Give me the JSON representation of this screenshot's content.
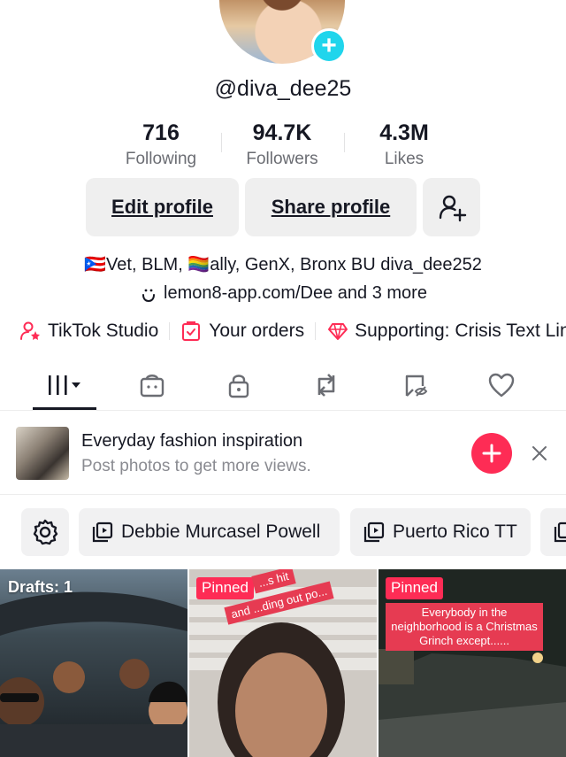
{
  "profile": {
    "username": "@diva_dee25",
    "stats": [
      {
        "value": "716",
        "label": "Following"
      },
      {
        "value": "94.7K",
        "label": "Followers"
      },
      {
        "value": "4.3M",
        "label": "Likes"
      }
    ],
    "buttons": {
      "edit": "Edit profile",
      "share": "Share profile"
    },
    "bio_line1": "🇵🇷Vet, BLM, 🏳️‍🌈ally, GenX, Bronx BU diva_dee252",
    "bio_link": "lemon8-app.com/Dee and 3 more"
  },
  "links": {
    "studio": "TikTok Studio",
    "orders": "Your orders",
    "supporting": "Supporting: Crisis Text Line"
  },
  "promo": {
    "title": "Everyday fashion inspiration",
    "subtitle": "Post photos to get more views."
  },
  "playlists": [
    "Debbie Murcasel Powell",
    "Puerto Rico TT"
  ],
  "grid": {
    "drafts": "Drafts: 1",
    "pinned": "Pinned",
    "video2_caption_a": "...s hit",
    "video2_caption_b": "and ...ding out po...",
    "video3_caption": "Everybody in the neighborhood is a Christmas Grinch except......"
  },
  "colors": {
    "accent": "#fe2c55",
    "add_badge": "#20d5ec",
    "button_bg": "#efefef"
  }
}
